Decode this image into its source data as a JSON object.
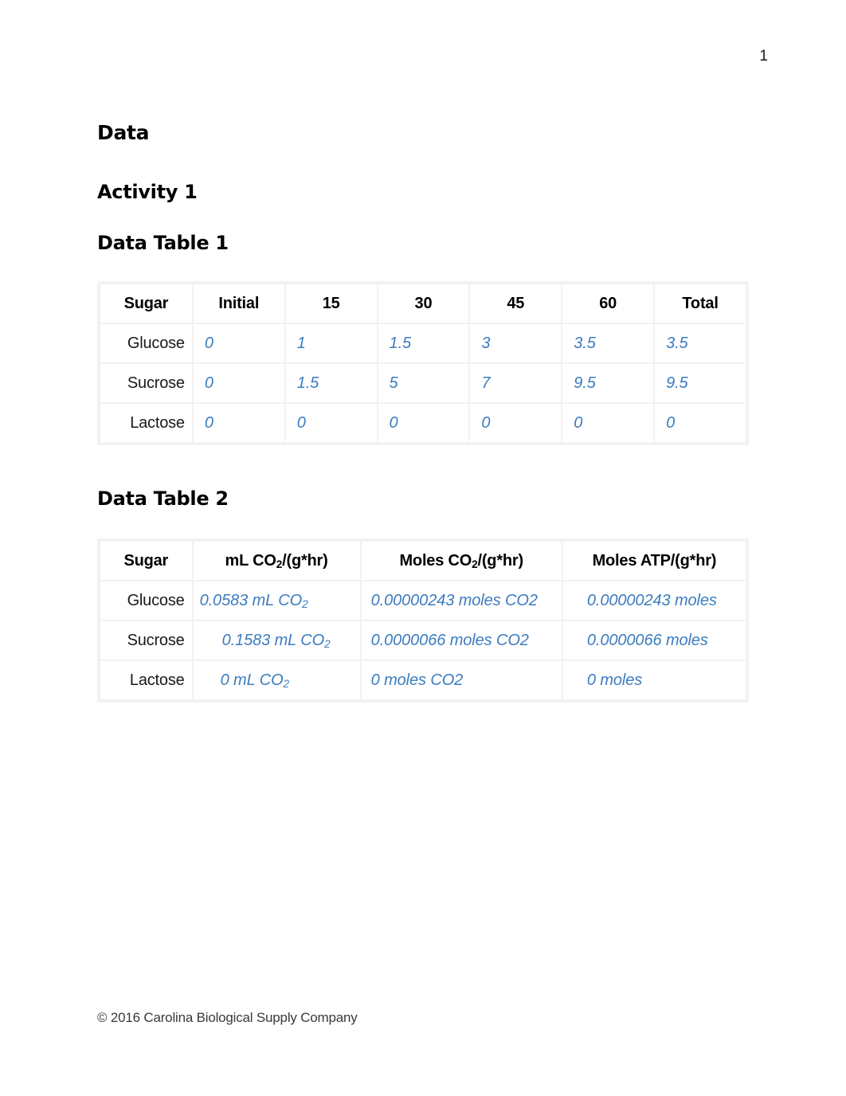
{
  "page": {
    "number": "1",
    "footer": "© 2016 Carolina Biological Supply Company"
  },
  "headings": {
    "data": "Data",
    "activity": "Activity 1",
    "table1_title": "Data Table 1",
    "table2_title": "Data Table 2"
  },
  "table1": {
    "columns": [
      "Sugar",
      "Initial",
      "15",
      "30",
      "45",
      "60",
      "Total"
    ],
    "rows": [
      {
        "sugar": "Glucose",
        "initial": "0",
        "t15": "1",
        "t30": "1.5",
        "t45": "3",
        "t60": "3.5",
        "total": "3.5"
      },
      {
        "sugar": "Sucrose",
        "initial": "0",
        "t15": "1.5",
        "t30": "5",
        "t45": "7",
        "t60": "9.5",
        "total": "9.5"
      },
      {
        "sugar": "Lactose",
        "initial": "0",
        "t15": "0",
        "t30": "0",
        "t45": "0",
        "t60": "0",
        "total": "0"
      }
    ]
  },
  "table2": {
    "columns": {
      "sugar": "Sugar",
      "ml_prefix": "mL CO",
      "ml_sub": "2",
      "ml_suffix": "/(g*hr)",
      "moles_prefix": "Moles CO",
      "moles_sub": "2",
      "moles_suffix": "/(g*hr)",
      "atp": "Moles ATP/(g*hr)"
    },
    "rows": [
      {
        "sugar": "Glucose",
        "ml_value": "0.0583 mL CO",
        "ml_sub": "2",
        "moles": "0.00000243 moles CO2",
        "atp": "0.00000243 moles"
      },
      {
        "sugar": "Sucrose",
        "ml_value": "0.1583 mL CO",
        "ml_sub": "2",
        "moles": "0.0000066 moles CO2",
        "atp": "0.0000066 moles"
      },
      {
        "sugar": "Lactose",
        "ml_value": "0 mL CO",
        "ml_sub": "2",
        "moles": "0 moles CO2",
        "atp": "0 moles"
      }
    ]
  },
  "colors": {
    "value_blue": "#3c7cbf",
    "heading_black": "#000000",
    "table_grid": "#f2f2f2"
  }
}
